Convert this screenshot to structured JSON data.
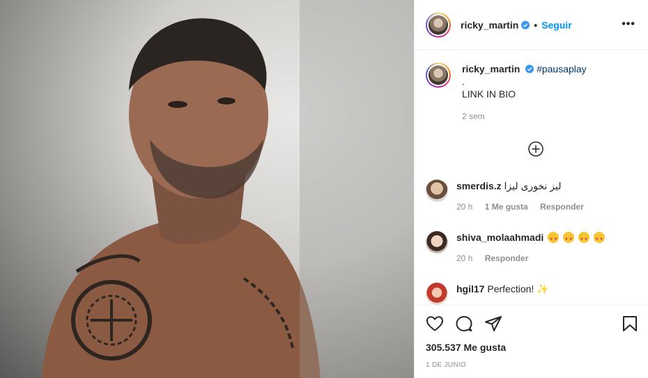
{
  "post": {
    "username": "ricky_martin",
    "follow_label": "Seguir",
    "separator": "•",
    "more_label": "•••",
    "caption": {
      "username": "ricky_martin",
      "hashtag": "#pausaplay",
      "line2": ".",
      "line3": "LINK IN BIO",
      "time": "2 sem"
    },
    "comments": [
      {
        "username": "smerdis.z",
        "text": "ليز نخوری ليزا",
        "time": "20 h",
        "likes": "1 Me gusta",
        "reply": "Responder"
      },
      {
        "username": "shiva_molaahmadi",
        "text": "",
        "time": "20 h",
        "reply": "Responder"
      },
      {
        "username": "hgil17",
        "text": "Perfection! ✨"
      }
    ],
    "likes_label": "305.537 Me gusta",
    "date_label": "1 DE JUNIO"
  },
  "icons": [
    "verified-icon",
    "more-icon",
    "load-more-comments-icon",
    "heart-icon",
    "comment-icon",
    "share-icon",
    "bookmark-icon"
  ],
  "colors": {
    "accent": "#0095f6",
    "text": "#262626",
    "muted": "#8e8e8e",
    "border": "#efefef"
  }
}
